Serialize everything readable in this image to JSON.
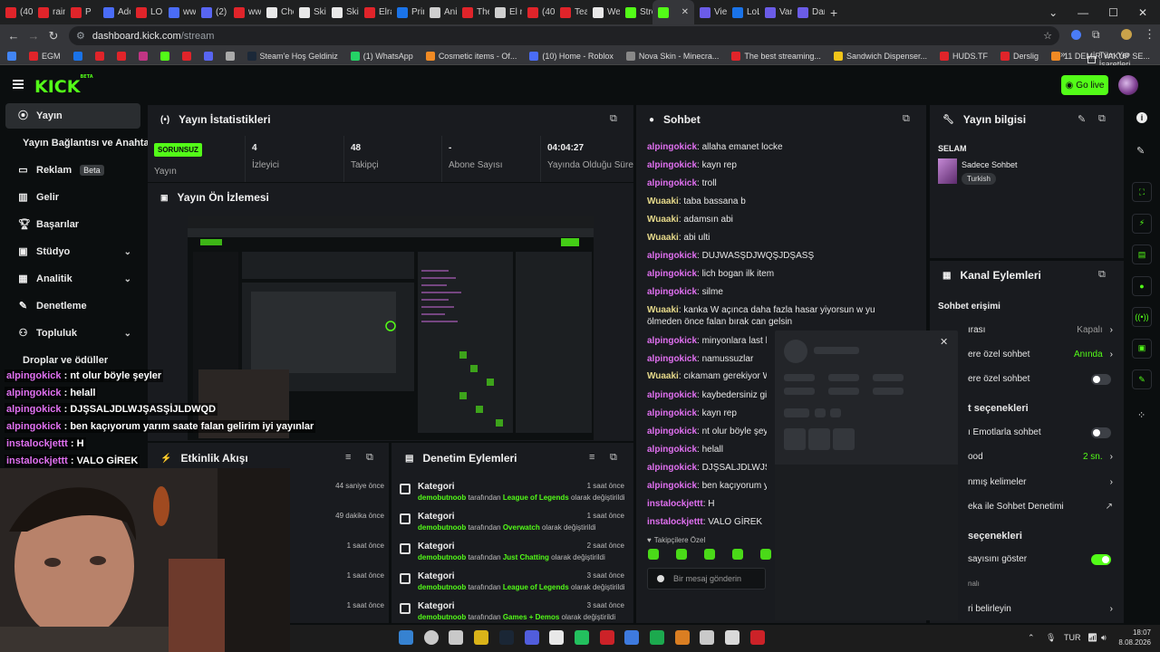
{
  "browser": {
    "tabs": [
      {
        "label": "(402",
        "color": "#e0242a"
      },
      {
        "label": "rain",
        "color": "#e0242a"
      },
      {
        "label": "P",
        "color": "#e0242a"
      },
      {
        "label": "Ado",
        "color": "#4a6cf7"
      },
      {
        "label": "LO",
        "color": "#e0242a"
      },
      {
        "label": "ww",
        "color": "#4a6cf7"
      },
      {
        "label": "(2) T",
        "color": "#5865f2"
      },
      {
        "label": "ww",
        "color": "#e0242a"
      },
      {
        "label": "Che",
        "color": "#e8e8e8"
      },
      {
        "label": "Skin",
        "color": "#e8e8e8"
      },
      {
        "label": "Skin",
        "color": "#e8e8e8"
      },
      {
        "label": "Elra",
        "color": "#e0242a"
      },
      {
        "label": "Prim",
        "color": "#1a73e8"
      },
      {
        "label": "Anin",
        "color": "#cfcfcf"
      },
      {
        "label": "The",
        "color": "#e0242a"
      },
      {
        "label": "El m",
        "color": "#cfcfcf"
      },
      {
        "label": "(402",
        "color": "#e0242a"
      },
      {
        "label": "Teac",
        "color": "#e0242a"
      },
      {
        "label": "We",
        "color": "#e8e8e8"
      },
      {
        "label": "Stre",
        "color": "#53fc18"
      },
      {
        "label": "",
        "color": "#53fc18",
        "active": true
      },
      {
        "label": "Viey",
        "color": "#6b5ce7"
      },
      {
        "label": "LoL",
        "color": "#1a73e8"
      },
      {
        "label": "Van",
        "color": "#6b5ce7"
      },
      {
        "label": "Dari",
        "color": "#6b5ce7"
      }
    ],
    "url_host": "dashboard.kick.com",
    "url_path": "/stream",
    "bookmarks": [
      {
        "label": "",
        "color": "#4285f4"
      },
      {
        "label": "EGM",
        "color": "#e0242a"
      },
      {
        "label": "",
        "color": "#1a73e8"
      },
      {
        "label": "",
        "color": "#e0242a"
      },
      {
        "label": "",
        "color": "#e0242a"
      },
      {
        "label": "",
        "color": "#c13584"
      },
      {
        "label": "",
        "color": "#53fc18"
      },
      {
        "label": "",
        "color": "#e0242a"
      },
      {
        "label": "",
        "color": "#5865f2"
      },
      {
        "label": "",
        "color": "#aaaaaa"
      },
      {
        "label": "Steam'e Hoş Geldiniz",
        "color": "#1b2838"
      },
      {
        "label": "(1) WhatsApp",
        "color": "#25d366"
      },
      {
        "label": "Cosmetic items - Of...",
        "color": "#f08a24"
      },
      {
        "label": "(10) Home - Roblox",
        "color": "#4a6cf7"
      },
      {
        "label": "Nova Skin - Minecra...",
        "color": "#888888"
      },
      {
        "label": "The best streaming...",
        "color": "#e0242a"
      },
      {
        "label": "Sandwich Dispenser...",
        "color": "#f0c419"
      },
      {
        "label": "HUDS.TF",
        "color": "#e0242a"
      },
      {
        "label": "Derslig",
        "color": "#e0242a"
      },
      {
        "label": "11 DEMİR YAKUP SE...",
        "color": "#f08a24"
      },
      {
        "label": "",
        "color": "#e0242a"
      },
      {
        "label": "",
        "color": "#e0242a"
      },
      {
        "label": "",
        "color": "#cccccc"
      }
    ],
    "all_bookmarks": "Tüm Yer İşaretleri"
  },
  "kick": {
    "logo": "KICK",
    "logo_sup": "BETA",
    "go_live": "Go live",
    "accent": "#53fc18"
  },
  "sidebar": {
    "items": [
      {
        "label": "Yayın",
        "icon": "broadcast-icon",
        "active": true
      },
      {
        "label": "Yayın Bağlantısı ve Anahtarı",
        "icon": ""
      },
      {
        "label": "Reklam",
        "icon": "ad-icon",
        "badge": "Beta"
      },
      {
        "label": "Gelir",
        "icon": "chart-icon"
      },
      {
        "label": "Başarılar",
        "icon": "trophy-icon"
      },
      {
        "label": "Stüdyo",
        "icon": "studio-icon",
        "chevron": true
      },
      {
        "label": "Analitik",
        "icon": "analytics-icon",
        "chevron": true
      },
      {
        "label": "Denetleme",
        "icon": "wrench-icon"
      },
      {
        "label": "Topluluk",
        "icon": "people-icon",
        "chevron": true
      },
      {
        "label": "Droplar ve ödüller",
        "icon": ""
      }
    ]
  },
  "stats_panel": {
    "title": "Yayın İstatistikleri",
    "status_badge": "SORUNSUZ",
    "status_label": "Yayın",
    "stats": [
      {
        "value": "4",
        "label": "İzleyici"
      },
      {
        "value": "48",
        "label": "Takipçi"
      },
      {
        "value": "-",
        "label": "Abone Sayısı"
      },
      {
        "value": "04:04:27",
        "label": "Yayında Olduğu Süre"
      }
    ]
  },
  "preview_panel": {
    "title": "Yayın Ön İzlemesi"
  },
  "overlay_chat": [
    {
      "user": "alpingokick",
      "text": "nt olur böyle şeyler"
    },
    {
      "user": "alpingokick",
      "text": "helall"
    },
    {
      "user": "alpingokick",
      "text": "DJŞSALJDLWJŞASŞİJLDWQD"
    },
    {
      "user": "alpingokick",
      "text": "ben kaçıyorum yarım saate falan gelirim iyi yayınlar"
    },
    {
      "user": "instalockjettt",
      "text": "H"
    },
    {
      "user": "instalockjettt",
      "text": "VALO GİREK"
    }
  ],
  "activity_panel": {
    "title": "Etkinlik Akışı",
    "times": [
      "44 saniye önce",
      "49 dakika önce",
      "1 saat önce",
      "1 saat önce",
      "1 saat önce"
    ]
  },
  "moderation_panel": {
    "title": "Denetim Eylemleri",
    "rows": [
      {
        "kind": "Kategori",
        "time": "1 saat önce",
        "user": "demobutnoob",
        "mid": "tarafından",
        "cat": "League of Legends",
        "end": "olarak değiştirildi"
      },
      {
        "kind": "Kategori",
        "time": "1 saat önce",
        "user": "demobutnoob",
        "mid": "tarafından",
        "cat": "Overwatch",
        "end": "olarak değiştirildi"
      },
      {
        "kind": "Kategori",
        "time": "2 saat önce",
        "user": "demobutnoob",
        "mid": "tarafından",
        "cat": "Just Chatting",
        "end": "olarak değiştirildi"
      },
      {
        "kind": "Kategori",
        "time": "3 saat önce",
        "user": "demobutnoob",
        "mid": "tarafından",
        "cat": "League of Legends",
        "end": "olarak değiştirildi"
      },
      {
        "kind": "Kategori",
        "time": "3 saat önce",
        "user": "demobutnoob",
        "mid": "tarafından",
        "cat": "Games + Demos",
        "end": "olarak değiştirildi"
      }
    ]
  },
  "chat_panel": {
    "title": "Sohbet",
    "messages": [
      {
        "user": "alpingokick",
        "color": "#e070f0",
        "text": "allaha emanet locke"
      },
      {
        "user": "alpingokick",
        "color": "#e070f0",
        "text": "kayn rep"
      },
      {
        "user": "alpingokick",
        "color": "#e070f0",
        "text": "troll"
      },
      {
        "user": "Wuaaki",
        "color": "#e6d98a",
        "text": "taba bassana b"
      },
      {
        "user": "Wuaaki",
        "color": "#e6d98a",
        "text": "adamsın abi"
      },
      {
        "user": "Wuaaki",
        "color": "#e6d98a",
        "text": "abi ulti"
      },
      {
        "user": "alpingokick",
        "color": "#e070f0",
        "text": "DUJWASŞDJWQŞJDŞASŞ"
      },
      {
        "user": "alpingokick",
        "color": "#e070f0",
        "text": "lich bogan ilk item"
      },
      {
        "user": "alpingokick",
        "color": "#e070f0",
        "text": "silme"
      },
      {
        "user": "Wuaaki",
        "color": "#e6d98a",
        "text": "kanka W açınca daha fazla hasar yiyorsun w yu ölmeden önce falan bırak can gelsin"
      },
      {
        "user": "alpingokick",
        "color": "#e070f0",
        "text": "minyonlara last hit"
      },
      {
        "user": "alpingokick",
        "color": "#e070f0",
        "text": "namussuzlar"
      },
      {
        "user": "Wuaaki",
        "color": "#e6d98a",
        "text": "cıkamam gerekiyor W s"
      },
      {
        "user": "alpingokick",
        "color": "#e070f0",
        "text": "kaybedersiniz girm"
      },
      {
        "user": "alpingokick",
        "color": "#e070f0",
        "text": "kayn rep"
      },
      {
        "user": "alpingokick",
        "color": "#e070f0",
        "text": "nt olur böyle şeyle"
      },
      {
        "user": "alpingokick",
        "color": "#e070f0",
        "text": "helall"
      },
      {
        "user": "alpingokick",
        "color": "#e070f0",
        "text": "DJŞSALJDLWJŞAS"
      },
      {
        "user": "alpingokick",
        "color": "#e070f0",
        "text": "ben kaçıyorum yar"
      },
      {
        "user": "instalockjettt",
        "color": "#e070f0",
        "text": "H"
      },
      {
        "user": "instalockjettt",
        "color": "#e070f0",
        "text": "VALO GİREK"
      }
    ],
    "followers_only": "Takipçilere Özel",
    "input_placeholder": "Bir mesaj gönderin"
  },
  "info_panel": {
    "title": "Yayın bilgisi",
    "stream_title": "SELAM",
    "category": "Sadece Sohbet",
    "tag": "Turkish"
  },
  "channel_actions": {
    "title": "Kanal Eylemleri",
    "section": "Sohbet erişimi",
    "rows": [
      {
        "label": "ırası",
        "value": "Kapalı",
        "kind": "chevron"
      },
      {
        "label": "ere özel sohbet",
        "value": "Anında",
        "kind": "chevron-green"
      },
      {
        "label": "ere özel sohbet",
        "kind": "toggle-off"
      },
      {
        "label": "t seçenekleri",
        "kind": "heading"
      },
      {
        "label": "ı Emotlarla sohbet",
        "kind": "toggle-off"
      },
      {
        "label": "ood",
        "value": "2 sn.",
        "kind": "chevron-green"
      },
      {
        "label": "nmış kelimeler",
        "kind": "chevron"
      },
      {
        "label": "eka ile Sohbet Denetimi",
        "kind": "external"
      },
      {
        "label": "seçenekleri",
        "kind": "heading"
      },
      {
        "label": "sayısını göster",
        "kind": "toggle-on"
      },
      {
        "label": "nalı",
        "kind": "dim"
      },
      {
        "label": "ri belirleyin",
        "kind": "chevron"
      }
    ]
  },
  "taskbar": {
    "lang": "TUR",
    "time": "18:07",
    "date": "8.08.2026"
  }
}
